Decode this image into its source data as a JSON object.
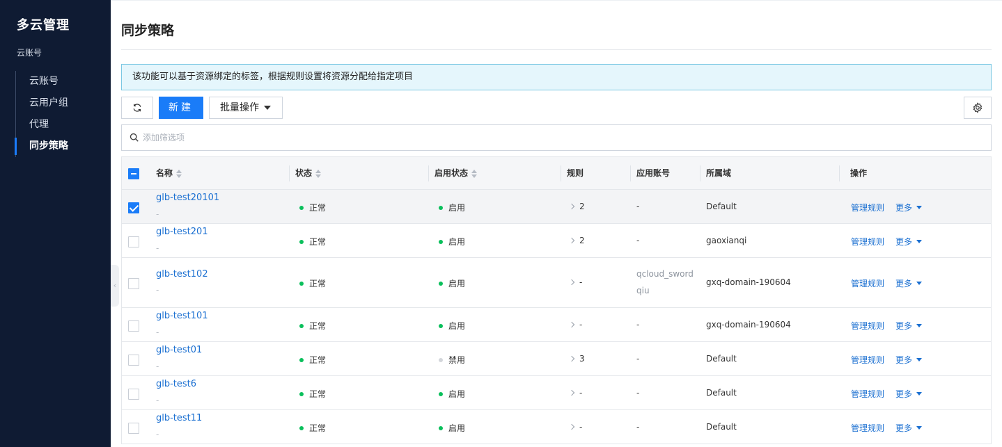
{
  "sidebar": {
    "title": "多云管理",
    "group": "云账号",
    "items": [
      {
        "label": "云账号",
        "active": false
      },
      {
        "label": "云用户组",
        "active": false
      },
      {
        "label": "代理",
        "active": false
      },
      {
        "label": "同步策略",
        "active": true
      }
    ]
  },
  "page": {
    "title": "同步策略",
    "notice": "该功能可以基于资源绑定的标签，根据规则设置将资源分配给指定项目"
  },
  "toolbar": {
    "refresh_icon": "refresh-icon",
    "new_label": "新建",
    "batch_label": "批量操作",
    "settings_icon": "gear-icon"
  },
  "filter": {
    "placeholder": "添加筛选项"
  },
  "table": {
    "columns": {
      "name": "名称",
      "status": "状态",
      "enable_status": "启用状态",
      "rules": "规则",
      "account": "应用账号",
      "domain": "所属域",
      "ops": "操作"
    },
    "rows": [
      {
        "name": "glb-test20101",
        "sub": "-",
        "status": "正常",
        "enabled": "启用",
        "enabled_on": true,
        "rules": "2",
        "account": "-",
        "account2": "",
        "domain": "Default",
        "checked": true
      },
      {
        "name": "glb-test201",
        "sub": "-",
        "status": "正常",
        "enabled": "启用",
        "enabled_on": true,
        "rules": "2",
        "account": "-",
        "account2": "",
        "domain": "gaoxianqi",
        "checked": false
      },
      {
        "name": "glb-test102",
        "sub": "-",
        "status": "正常",
        "enabled": "启用",
        "enabled_on": true,
        "rules": "-",
        "account": "qcloud_sword",
        "account2": "qiu",
        "domain": "gxq-domain-190604",
        "checked": false
      },
      {
        "name": "glb-test101",
        "sub": "-",
        "status": "正常",
        "enabled": "启用",
        "enabled_on": true,
        "rules": "-",
        "account": "-",
        "account2": "",
        "domain": "gxq-domain-190604",
        "checked": false
      },
      {
        "name": "glb-test01",
        "sub": "-",
        "status": "正常",
        "enabled": "禁用",
        "enabled_on": false,
        "rules": "3",
        "account": "-",
        "account2": "",
        "domain": "Default",
        "checked": false
      },
      {
        "name": "glb-test6",
        "sub": "-",
        "status": "正常",
        "enabled": "启用",
        "enabled_on": true,
        "rules": "-",
        "account": "-",
        "account2": "",
        "domain": "Default",
        "checked": false
      },
      {
        "name": "glb-test11",
        "sub": "-",
        "status": "正常",
        "enabled": "启用",
        "enabled_on": true,
        "rules": "-",
        "account": "-",
        "account2": "",
        "domain": "Default",
        "checked": false
      }
    ],
    "op_manage": "管理规则",
    "op_more": "更多"
  },
  "colors": {
    "sidebar_bg": "#0f1b33",
    "primary": "#1a7cf8",
    "link": "#1a6fd1",
    "status_green": "#0abf5b",
    "notice_bg": "#e5f6fc"
  }
}
